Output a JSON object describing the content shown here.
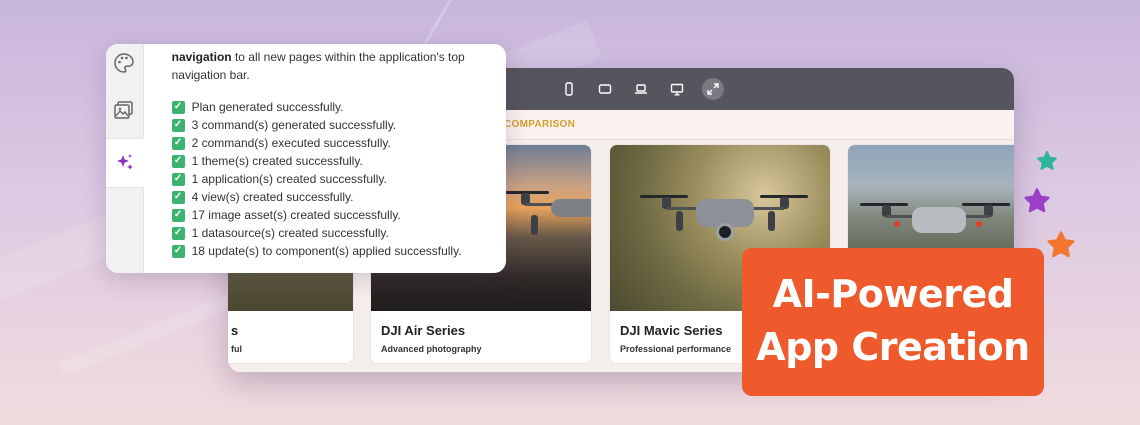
{
  "panel": {
    "intro_bold": "navigation",
    "intro_rest": " to all new pages within the application's top navigation bar.",
    "statuses": [
      "Plan generated successfully.",
      "3 command(s) generated successfully.",
      "2 command(s) executed successfully.",
      "1 theme(s) created successfully.",
      "1 application(s) created successfully.",
      "4 view(s) created successfully.",
      "17 image asset(s) created successfully.",
      "1 datasource(s) created successfully.",
      "18 update(s) to component(s) applied successfully."
    ],
    "sidebar_icons": [
      "palette-icon",
      "image-gallery-icon",
      "ai-sparkle-icon"
    ]
  },
  "preview": {
    "toolbar_icons": [
      "mobile-view-icon",
      "tablet-view-icon",
      "laptop-view-icon",
      "desktop-view-icon",
      "fullscreen-icon"
    ],
    "nav_link": "COMPARISON",
    "cards": [
      {
        "title": "s",
        "subtitle": "ful"
      },
      {
        "title": "DJI Air Series",
        "subtitle": "Advanced photography"
      },
      {
        "title": "DJI Mavic Series",
        "subtitle": "Professional performance"
      },
      {
        "title": "",
        "subtitle": ""
      }
    ]
  },
  "badge": {
    "line1": "AI-Powered",
    "line2": "App Creation"
  },
  "colors": {
    "badge": "#ee5a2c",
    "accent_gold": "#d0a030",
    "check_green": "#3cb371",
    "toolbar": "#56545c"
  }
}
